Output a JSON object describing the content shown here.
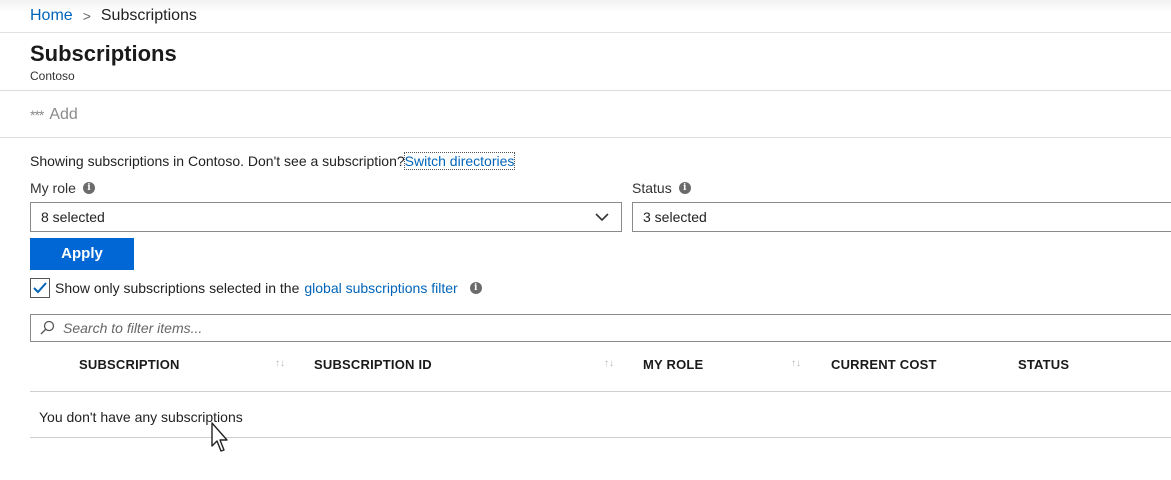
{
  "breadcrumb": {
    "home": "Home",
    "separator": ">",
    "current": "Subscriptions"
  },
  "page": {
    "title": "Subscriptions",
    "subtitle": "Contoso"
  },
  "toolbar": {
    "add_label": "Add",
    "add_icon": "***"
  },
  "info": {
    "text": "Showing subscriptions in Contoso. Don't see a subscription?",
    "link": "Switch directories"
  },
  "filters": {
    "role_label": "My role",
    "role_value": "8 selected",
    "status_label": "Status",
    "status_value": "3 selected",
    "info_glyph": "i"
  },
  "apply_label": "Apply",
  "checkbox": {
    "checked": true,
    "text": "Show only subscriptions selected in the",
    "link": "global subscriptions filter"
  },
  "search": {
    "placeholder": "Search to filter items..."
  },
  "table": {
    "columns": [
      "SUBSCRIPTION",
      "SUBSCRIPTION ID",
      "MY ROLE",
      "CURRENT COST",
      "STATUS"
    ],
    "sort_glyph": "↑↓",
    "empty_message": "You don't have any subscriptions"
  },
  "colors": {
    "link": "#0064b9",
    "primary_button": "#0067d4"
  },
  "icons": [
    "chevron-right-icon",
    "more-icon",
    "info-icon",
    "chevron-down-icon",
    "checkmark-icon",
    "search-icon",
    "sort-icon",
    "mouse-cursor-icon"
  ]
}
